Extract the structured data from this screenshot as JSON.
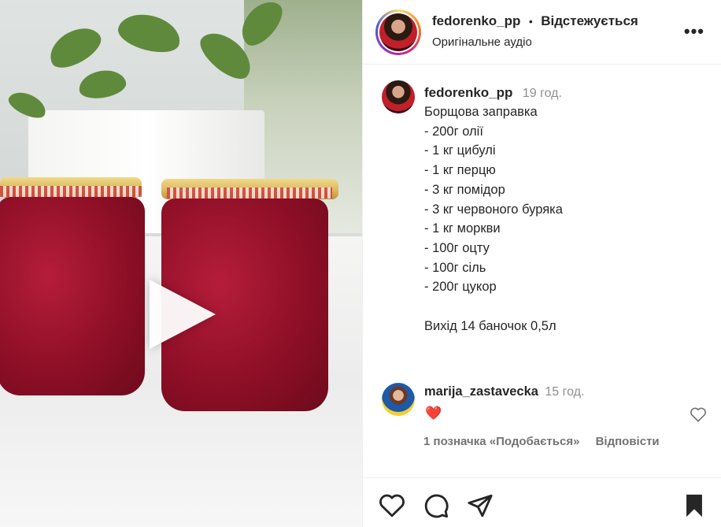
{
  "post": {
    "author": "fedorenko_pp",
    "separator": "•",
    "follow_status": "Відстежується",
    "audio": "Оригінальне аудіо",
    "more_label": "•••"
  },
  "caption": {
    "author": "fedorenko_pp",
    "time": "19 год.",
    "lines": [
      "Борщова заправка",
      "- 200г олії",
      "- 1 кг цибулі",
      "- 1 кг перцю",
      "- 3 кг помідор",
      "- 3 кг червоного буряка",
      "- 1 кг моркви",
      "- 100г оцту",
      "- 100г сіль",
      "- 200г цукор",
      "",
      "Вихід 14 баночок 0,5л"
    ]
  },
  "comment": {
    "author": "marija_zastavecka",
    "time": "15 год.",
    "text": "❤️",
    "likes_label": "1 позначка «Подобається»",
    "reply_label": "Відповісти"
  },
  "icons": {
    "play": "play-icon",
    "like": "heart-icon",
    "comment": "comment-icon",
    "share": "paper-plane-icon",
    "save": "bookmark-icon"
  },
  "colors": {
    "text": "#262626",
    "muted": "#8e8e8e",
    "heart": "#ed1c3a",
    "border": "#efefef"
  }
}
